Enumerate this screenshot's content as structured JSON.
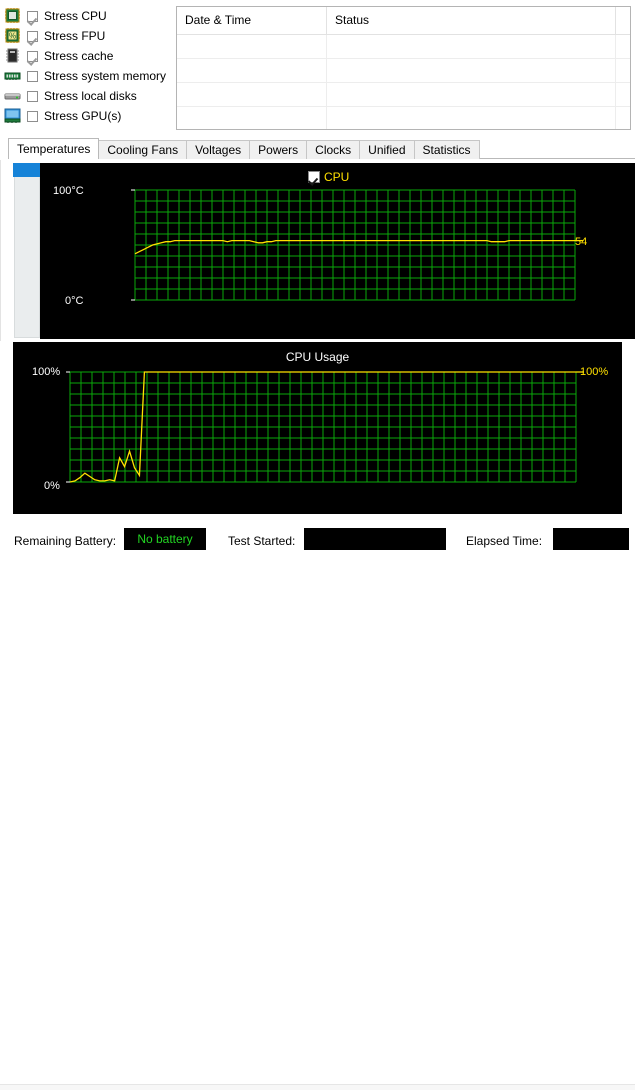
{
  "stress_options": [
    {
      "icon": "cpu-chip-icon",
      "label": "Stress CPU",
      "checked": true
    },
    {
      "icon": "fpu-percent-icon",
      "label": "Stress FPU",
      "checked": true
    },
    {
      "icon": "cache-chip-icon",
      "label": "Stress cache",
      "checked": true
    },
    {
      "icon": "memory-stick-icon",
      "label": "Stress system memory",
      "checked": false
    },
    {
      "icon": "hard-disk-icon",
      "label": "Stress local disks",
      "checked": false
    },
    {
      "icon": "gpu-card-icon",
      "label": "Stress GPU(s)",
      "checked": false
    }
  ],
  "log_table": {
    "columns": [
      "Date & Time",
      "Status"
    ],
    "rows": []
  },
  "tabs": [
    {
      "label": "Temperatures",
      "active": true
    },
    {
      "label": "Cooling Fans",
      "active": false
    },
    {
      "label": "Voltages",
      "active": false
    },
    {
      "label": "Powers",
      "active": false
    },
    {
      "label": "Clocks",
      "active": false
    },
    {
      "label": "Unified",
      "active": false
    },
    {
      "label": "Statistics",
      "active": false
    }
  ],
  "sensor_list": {
    "selected_index": 0,
    "items": [
      ""
    ]
  },
  "status_bar": {
    "battery_label": "Remaining Battery:",
    "battery_value": "No battery",
    "test_started_label": "Test Started:",
    "test_started_value": "",
    "elapsed_label": "Elapsed Time:",
    "elapsed_value": ""
  },
  "colors": {
    "plot_background": "#000000",
    "grid": "#0aa80a",
    "series": "#ffe000",
    "accent_selection": "#1683d8",
    "battery_text": "#22d422",
    "title_text": "#ffffff"
  },
  "chart_data": [
    {
      "type": "line",
      "title": "",
      "legend": [
        {
          "label": "CPU",
          "checked": true,
          "color": "#ffe000"
        }
      ],
      "legend_position": "top-center",
      "xlabel": "",
      "ylabel": "",
      "ylim": [
        0,
        100
      ],
      "ytick_labels": [
        "100°C",
        "0°C"
      ],
      "ytick_values": [
        100,
        0
      ],
      "grid": true,
      "current_value_label": "54",
      "series": [
        {
          "name": "CPU",
          "unit": "°C",
          "values": [
            42,
            44,
            46,
            48,
            50,
            51,
            52,
            53,
            53,
            54,
            54,
            54,
            54,
            54,
            54,
            54,
            54,
            54,
            54,
            54,
            54,
            53,
            54,
            54,
            54,
            54,
            54,
            53,
            52,
            52,
            53,
            53,
            54,
            54,
            54,
            54,
            54,
            54,
            54,
            54,
            54,
            54,
            54,
            54,
            54,
            54,
            54,
            54,
            54,
            54,
            54,
            54,
            54,
            54,
            54,
            54,
            54,
            54,
            54,
            54,
            54,
            54,
            54,
            54,
            54,
            54,
            54,
            54,
            54,
            54,
            54,
            54,
            54,
            54,
            54,
            54,
            54,
            54,
            54,
            54,
            54,
            53,
            53,
            53,
            53,
            54,
            54,
            54,
            54,
            54,
            54,
            54,
            54,
            54,
            54,
            54,
            54,
            54,
            54,
            54,
            54
          ]
        }
      ]
    },
    {
      "type": "line",
      "title": "CPU Usage",
      "legend": [],
      "xlabel": "",
      "ylabel": "",
      "ylim": [
        0,
        100
      ],
      "ytick_labels": [
        "100%",
        "0%"
      ],
      "ytick_values": [
        100,
        0
      ],
      "grid": true,
      "current_value_label": "100%",
      "series": [
        {
          "name": "CPU Usage",
          "unit": "%",
          "values": [
            0,
            1,
            4,
            8,
            5,
            2,
            1,
            1,
            2,
            1,
            22,
            14,
            28,
            13,
            6,
            100,
            100,
            100,
            100,
            100,
            100,
            100,
            100,
            100,
            100,
            100,
            100,
            100,
            100,
            100,
            100,
            100,
            100,
            100,
            100,
            100,
            100,
            100,
            100,
            100,
            100,
            100,
            100,
            100,
            100,
            100,
            100,
            100,
            100,
            100,
            100,
            100,
            100,
            100,
            100,
            100,
            100,
            100,
            100,
            100,
            100,
            100,
            100,
            100,
            100,
            100,
            100,
            100,
            100,
            100,
            100,
            100,
            100,
            100,
            100,
            100,
            100,
            100,
            100,
            100,
            100,
            100,
            100,
            100,
            100,
            100,
            100,
            100,
            100,
            100,
            100,
            100,
            100,
            100,
            100,
            100,
            100,
            100,
            100,
            100,
            100,
            100,
            100
          ]
        }
      ]
    }
  ]
}
